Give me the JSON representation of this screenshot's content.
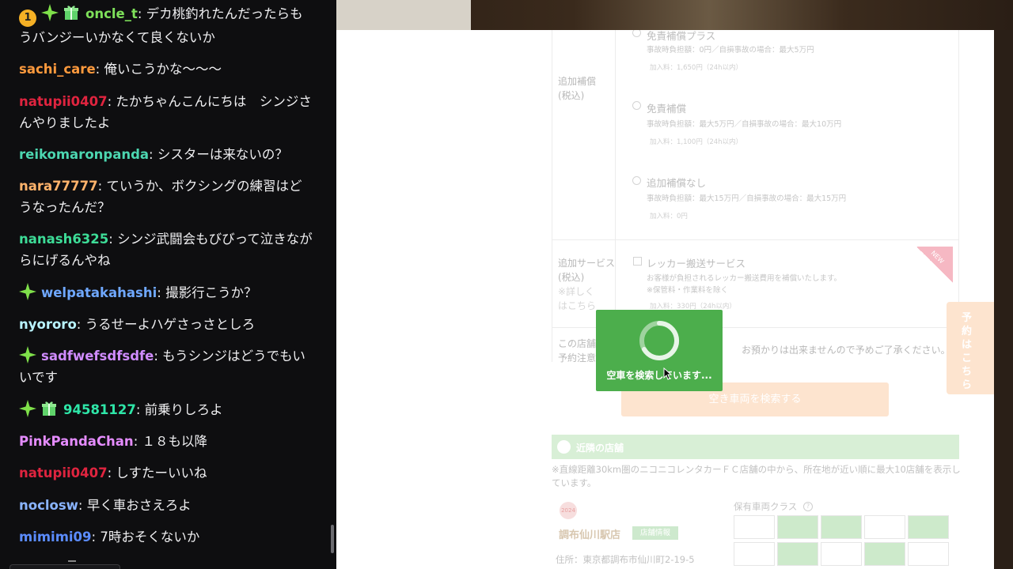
{
  "chat": {
    "messages": [
      {
        "badges": [
          "1",
          "spark",
          "gift"
        ],
        "user": "oncle_t",
        "color": "#7ee05a",
        "text": ": デカ桃釣れたんだったらもうバンジーいかなくて良くないか"
      },
      {
        "badges": [],
        "user": "sachi_care",
        "color": "#ff9a3d",
        "text": ": 俺いこうかな〜〜〜"
      },
      {
        "badges": [],
        "user": "natupii0407",
        "color": "#e0243f",
        "text": ": たかちゃんこんにちは　シンジさんやりましたよ"
      },
      {
        "badges": [],
        "user": "reikomaronpanda",
        "color": "#4cd6b0",
        "text": ": シスターは来ないの？"
      },
      {
        "badges": [],
        "user": "nara77777",
        "color": "#ffb36b",
        "text": ": ていうか、ボクシングの練習はどうなったんだ？"
      },
      {
        "badges": [],
        "user": "nanash6325",
        "color": "#3ddc97",
        "text": ": シンジ武闘会もびびって泣きながらにげるんやね"
      },
      {
        "badges": [
          "spark"
        ],
        "user": "welpatakahashi",
        "color": "#6fa8ff",
        "text": ": 撮影行こうか？"
      },
      {
        "badges": [],
        "user": "nyororo",
        "color": "#b9f3ff",
        "text": ": うるせーよハゲさっさとしろ"
      },
      {
        "badges": [
          "spark"
        ],
        "user": "sadfwefsdfsdfe",
        "color": "#d08cff",
        "text": ": もうシンジはどうでもいいです"
      },
      {
        "badges": [
          "spark",
          "gift"
        ],
        "user": "94581127",
        "color": "#2ee6a8",
        "text": ": 前乗りしろよ"
      },
      {
        "badges": [],
        "user": "PinkPandaChan",
        "color": "#e58cff",
        "text": ": １８も以降"
      },
      {
        "badges": [],
        "user": "natupii0407",
        "color": "#e0243f",
        "text": ": しすたーいいね"
      },
      {
        "badges": [],
        "user": "noclosw",
        "color": "#8ab4ff",
        "text": ": 早く車おさえろよ"
      },
      {
        "badges": [],
        "user": "mimimi09",
        "color": "#5b8cff",
        "text": ": 7時おそくないか"
      }
    ]
  },
  "page": {
    "options": [
      {
        "title": "免責補償プラス",
        "sub": "事故時負担額：0円／自損事故の場合：最大5万円",
        "fee": "加入料：1,650円（24h以内）"
      },
      {
        "title": "免責補償",
        "sub": "事故時負担額：最大5万円／自損事故の場合：最大10万円",
        "fee": "加入料：1,100円（24h以内）"
      },
      {
        "title": "追加補償なし",
        "sub": "事故時負担額：最大15万円／自損事故の場合：最大15万円",
        "fee": "加入料：0円"
      }
    ],
    "extra_coverage_label": "追加補償\n(税込)",
    "additional_service_label": "追加サービス\n(税込)",
    "details_link": "※詳しくはこちら",
    "tow_title": "レッカー搬送サービス",
    "tow_sub": "お客様が負担されるレッカー搬送費用を補償いたします。",
    "tow_note": "※保管料・作業料を除く",
    "tow_fee": "加入料：330円（24h以内）",
    "new_badge": "NEW",
    "store_notice_label": "この店舗\n予約注意",
    "store_notice_text": "お預かりは出来ませんので予めご了承ください。",
    "search_button": "空き車両を検索する",
    "nearby_title": "近隣の店舗",
    "nearby_desc": "※直線距離30km圏のニコニコレンタカーＦＣ店舗の中から、所在地が近い順に最大10店舗を表示しています。",
    "store_badge": "2024",
    "store_name": "調布仙川駅店",
    "store_tag": "店舗情報",
    "store_address": "住所：東京都調布市仙川町2-19-5",
    "class_title": "保有車両クラス",
    "class_help": "?",
    "reserve_tab": "予約はこちら",
    "loading_text": "空車を検索しています..."
  },
  "colors": {
    "chat_bg": "#0e0e10",
    "loading_green": "#4cae4c",
    "reserve_orange": "#fde4cf"
  }
}
